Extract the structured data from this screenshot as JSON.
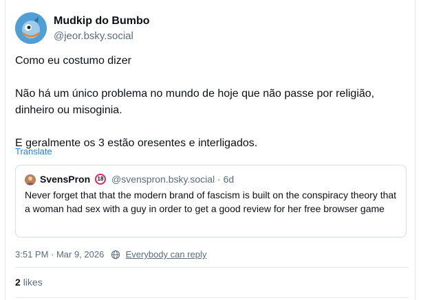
{
  "post": {
    "author": {
      "display_name": "Mudkip do Bumbo",
      "handle": "@jeor.bsky.social"
    },
    "paragraphs": [
      "Como eu costumo dizer",
      "Não há um único problema no mundo de hoje que não passe por religião, dinheiro ou misoginia.",
      "E geralmente os 3 estão oresentes e interligados."
    ],
    "translate_label": "Translate",
    "timestamp": "3:51 PM · Mar 9, 2026",
    "reply_setting": "Everybody can reply",
    "likes_count": "2",
    "likes_label": "likes"
  },
  "quote": {
    "display_name": "SvensPron",
    "badge": "18",
    "handle_time": "@svenspron.bsky.social · 6d",
    "text": "Never forget that that the modern brand of fascism is built on the conspiracy theory that a woman had sex with a guy in order to get a good review for her free browser game"
  },
  "colors": {
    "link": "#1f7ee8",
    "muted": "#5a6b7d",
    "text": "#0b0f14",
    "border": "#d5dde5",
    "badge_ring": "#e0245e"
  },
  "icons": {
    "reply_setting": "globe-icon"
  }
}
